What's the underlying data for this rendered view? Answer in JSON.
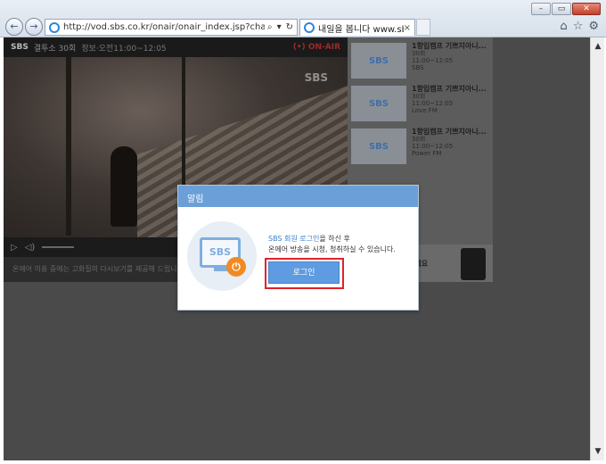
{
  "browser": {
    "address": "http://vod.sbs.co.kr/onair/onair_index.jsp?channel=espn",
    "tab_title": "내일을 봅니다 www.sbs.co...",
    "tab_close": "×",
    "window_buttons": [
      "–",
      "▭",
      "✕"
    ],
    "nav": {
      "back": "←",
      "forward": "→"
    },
    "addr_tools": [
      "⌕",
      "▾",
      "↻"
    ],
    "toolbar_icons": [
      "home-icon",
      "star-icon",
      "gear-icon"
    ]
  },
  "player": {
    "channel_logo": "SBS",
    "program": "결투소 30회",
    "program_sub": "정보·오전11:00~12:05",
    "onair": "(•) ON-AIR",
    "watermark": "SBS",
    "notice": "온에어 이용 중에는 고화질의 다시보기를 제공해 드립니다."
  },
  "sidebar": {
    "programs": [
      {
        "thumb": "SBS",
        "title": "1항입캠프 기쁘지아니...",
        "ep": "30회",
        "time": "11:00~12:05",
        "channel": "SBS"
      },
      {
        "thumb": "SBS",
        "title": "1항입캠프 기쁘지아니...",
        "ep": "30회",
        "time": "11:00~12:05",
        "channel": "Love FM"
      },
      {
        "thumb": "SBS",
        "title": "1항입캠프 기쁘지아니...",
        "ep": "30회",
        "time": "11:00~12:05",
        "channel": "Power FM"
      }
    ],
    "ad_text": "하세요"
  },
  "modal": {
    "title": "알림",
    "illus_logo": "SBS",
    "msg_link": "SBS 회원 로그인",
    "msg_rest": "을 하신 후",
    "msg_line2": "온에어 방송을 시청, 청취하실 수 있습니다.",
    "login_label": "로그인"
  },
  "colors": {
    "modal_header": "#6b9fd8",
    "login_button": "#5f9be0",
    "focus_outline": "#e0222a",
    "overlay": "#4a4a4a"
  }
}
